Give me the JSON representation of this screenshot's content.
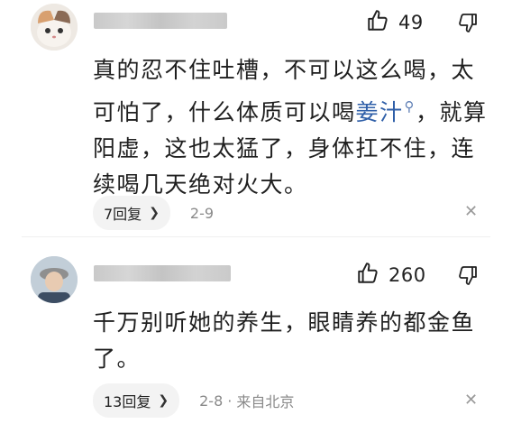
{
  "comments": [
    {
      "likes": "49",
      "text_before_link": "真的忍不住吐槽，不可以这么喝，太可怕了，什么体质可以喝",
      "link_text": "姜汁",
      "text_after_link": "，就算阳虚，这也太猛了，身体扛不住，连续喝几天绝对火大。",
      "reply_label": "7回复",
      "date": "2-9",
      "location": ""
    },
    {
      "likes": "260",
      "text_before_link": "千万别听她的养生，眼睛养的都金鱼了。",
      "link_text": "",
      "text_after_link": "",
      "reply_label": "13回复",
      "date": "2-8",
      "location": "来自北京"
    }
  ],
  "icons": {
    "like": "thumbs-up-icon",
    "dislike": "thumbs-down-icon",
    "search": "search-icon",
    "chevron": "chevron-right-icon",
    "close": "close-icon"
  },
  "colors": {
    "link": "#2f5fa8",
    "meta_text": "#8a8a8a",
    "pill_bg": "#f3f3f3"
  }
}
